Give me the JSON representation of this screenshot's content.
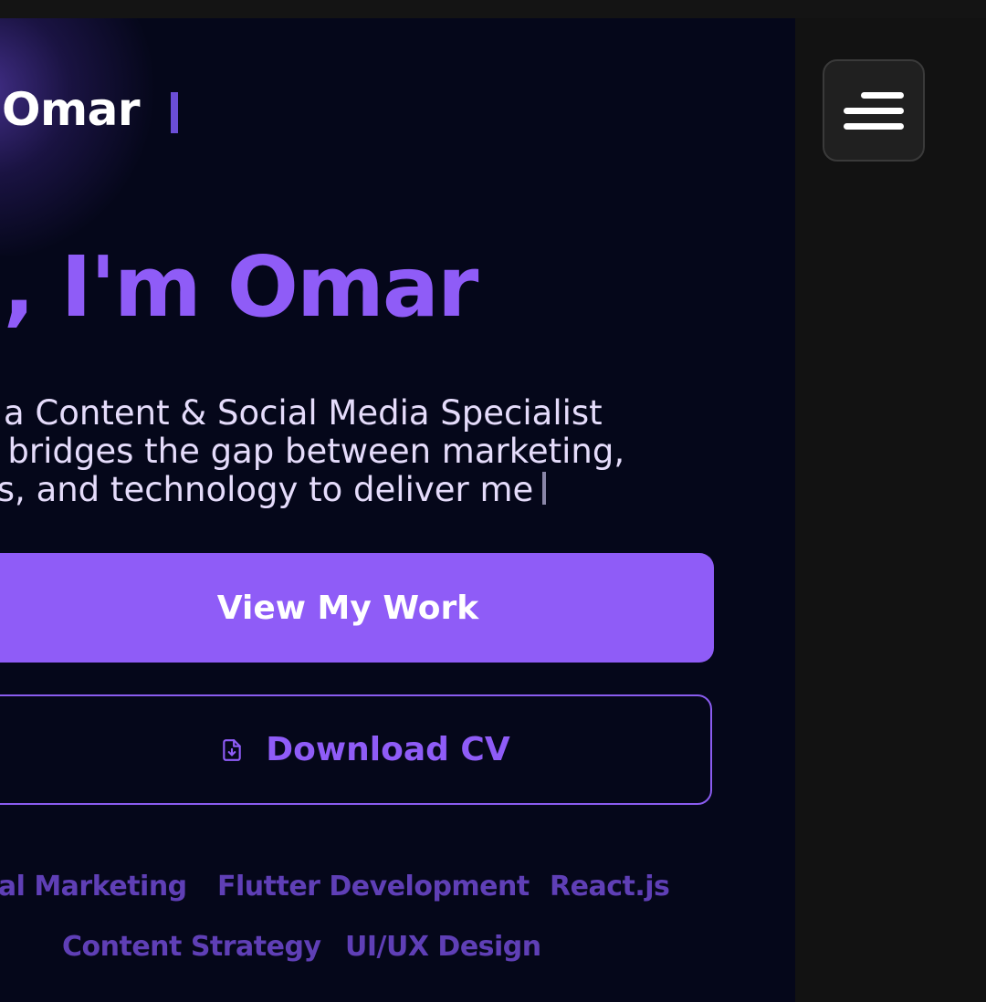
{
  "header": {
    "logo_text": "Omar"
  },
  "hero": {
    "title": "i, I'm Omar",
    "description_lines": [
      "a Content & Social Media Specialist",
      "o bridges the gap between marketing,",
      "es, and technology to deliver me"
    ]
  },
  "actions": {
    "primary_label": "View My Work",
    "secondary_label": "Download CV"
  },
  "skills": [
    "tal Marketing",
    "Flutter Development",
    "React.js",
    "Content Strategy",
    "UI/UX Design"
  ],
  "colors": {
    "accent": "#8f5cf7",
    "panel_background": "#05071a",
    "page_background": "#121212",
    "tag_text": "#5f3fb6"
  },
  "icons": {
    "download": "file-download-icon",
    "menu": "hamburger-menu-icon"
  }
}
